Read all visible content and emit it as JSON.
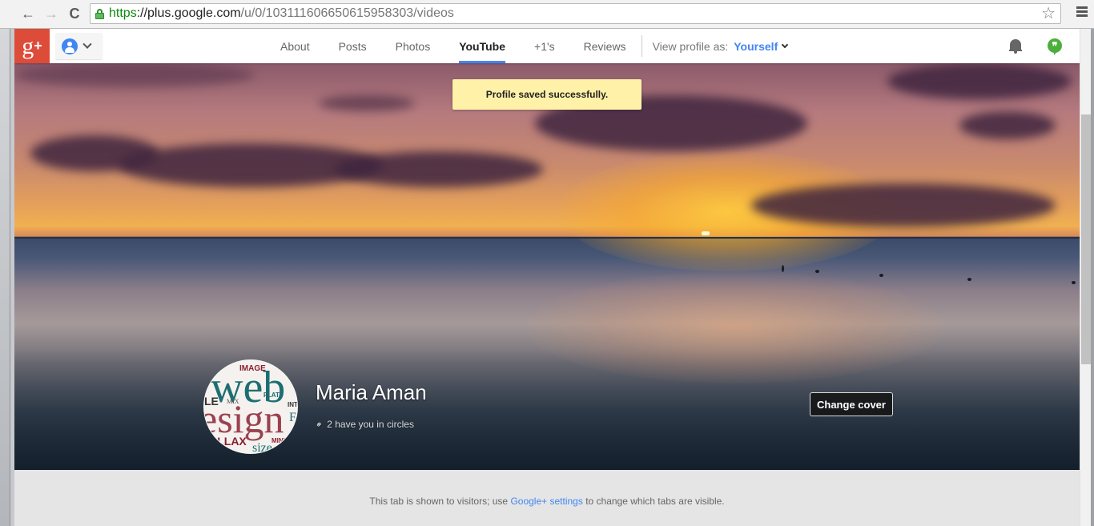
{
  "browser": {
    "url": {
      "scheme": "https",
      "host": "://plus.google.com",
      "path": "/u/0/103111606650615958303/videos"
    },
    "back_icon": "←",
    "forward_icon": "→",
    "reload_icon": "C",
    "star_icon": "☆"
  },
  "header": {
    "logo_text": "g",
    "logo_plus": "+",
    "tabs": [
      {
        "label": "About",
        "active": false
      },
      {
        "label": "Posts",
        "active": false
      },
      {
        "label": "Photos",
        "active": false
      },
      {
        "label": "YouTube",
        "active": true
      },
      {
        "label": "+1's",
        "active": false
      },
      {
        "label": "Reviews",
        "active": false
      }
    ],
    "view_profile_as_label": "View profile as:",
    "view_profile_as_value": "Yourself",
    "hangouts_glyph": "❞"
  },
  "toast": {
    "message": "Profile saved successfully."
  },
  "profile": {
    "name": "Maria Aman",
    "circles_text": "2 have you in circles",
    "link_icon": "⚭",
    "change_cover_label": "Change cover",
    "photo_words": [
      "IMAGE",
      "web",
      "FLAT",
      "LE",
      "MIX",
      "esign",
      "RALLAX",
      "MINIM",
      "size",
      "INT",
      "F"
    ]
  },
  "notice": {
    "before": "This tab is shown to visitors; use ",
    "link": "Google+ settings",
    "after": " to change which tabs are visible."
  },
  "colors": {
    "gplus_red": "#dd4b39",
    "accent_blue": "#4285f4",
    "toast_bg": "#fff1a8",
    "hangouts_green": "#4caf3c"
  }
}
